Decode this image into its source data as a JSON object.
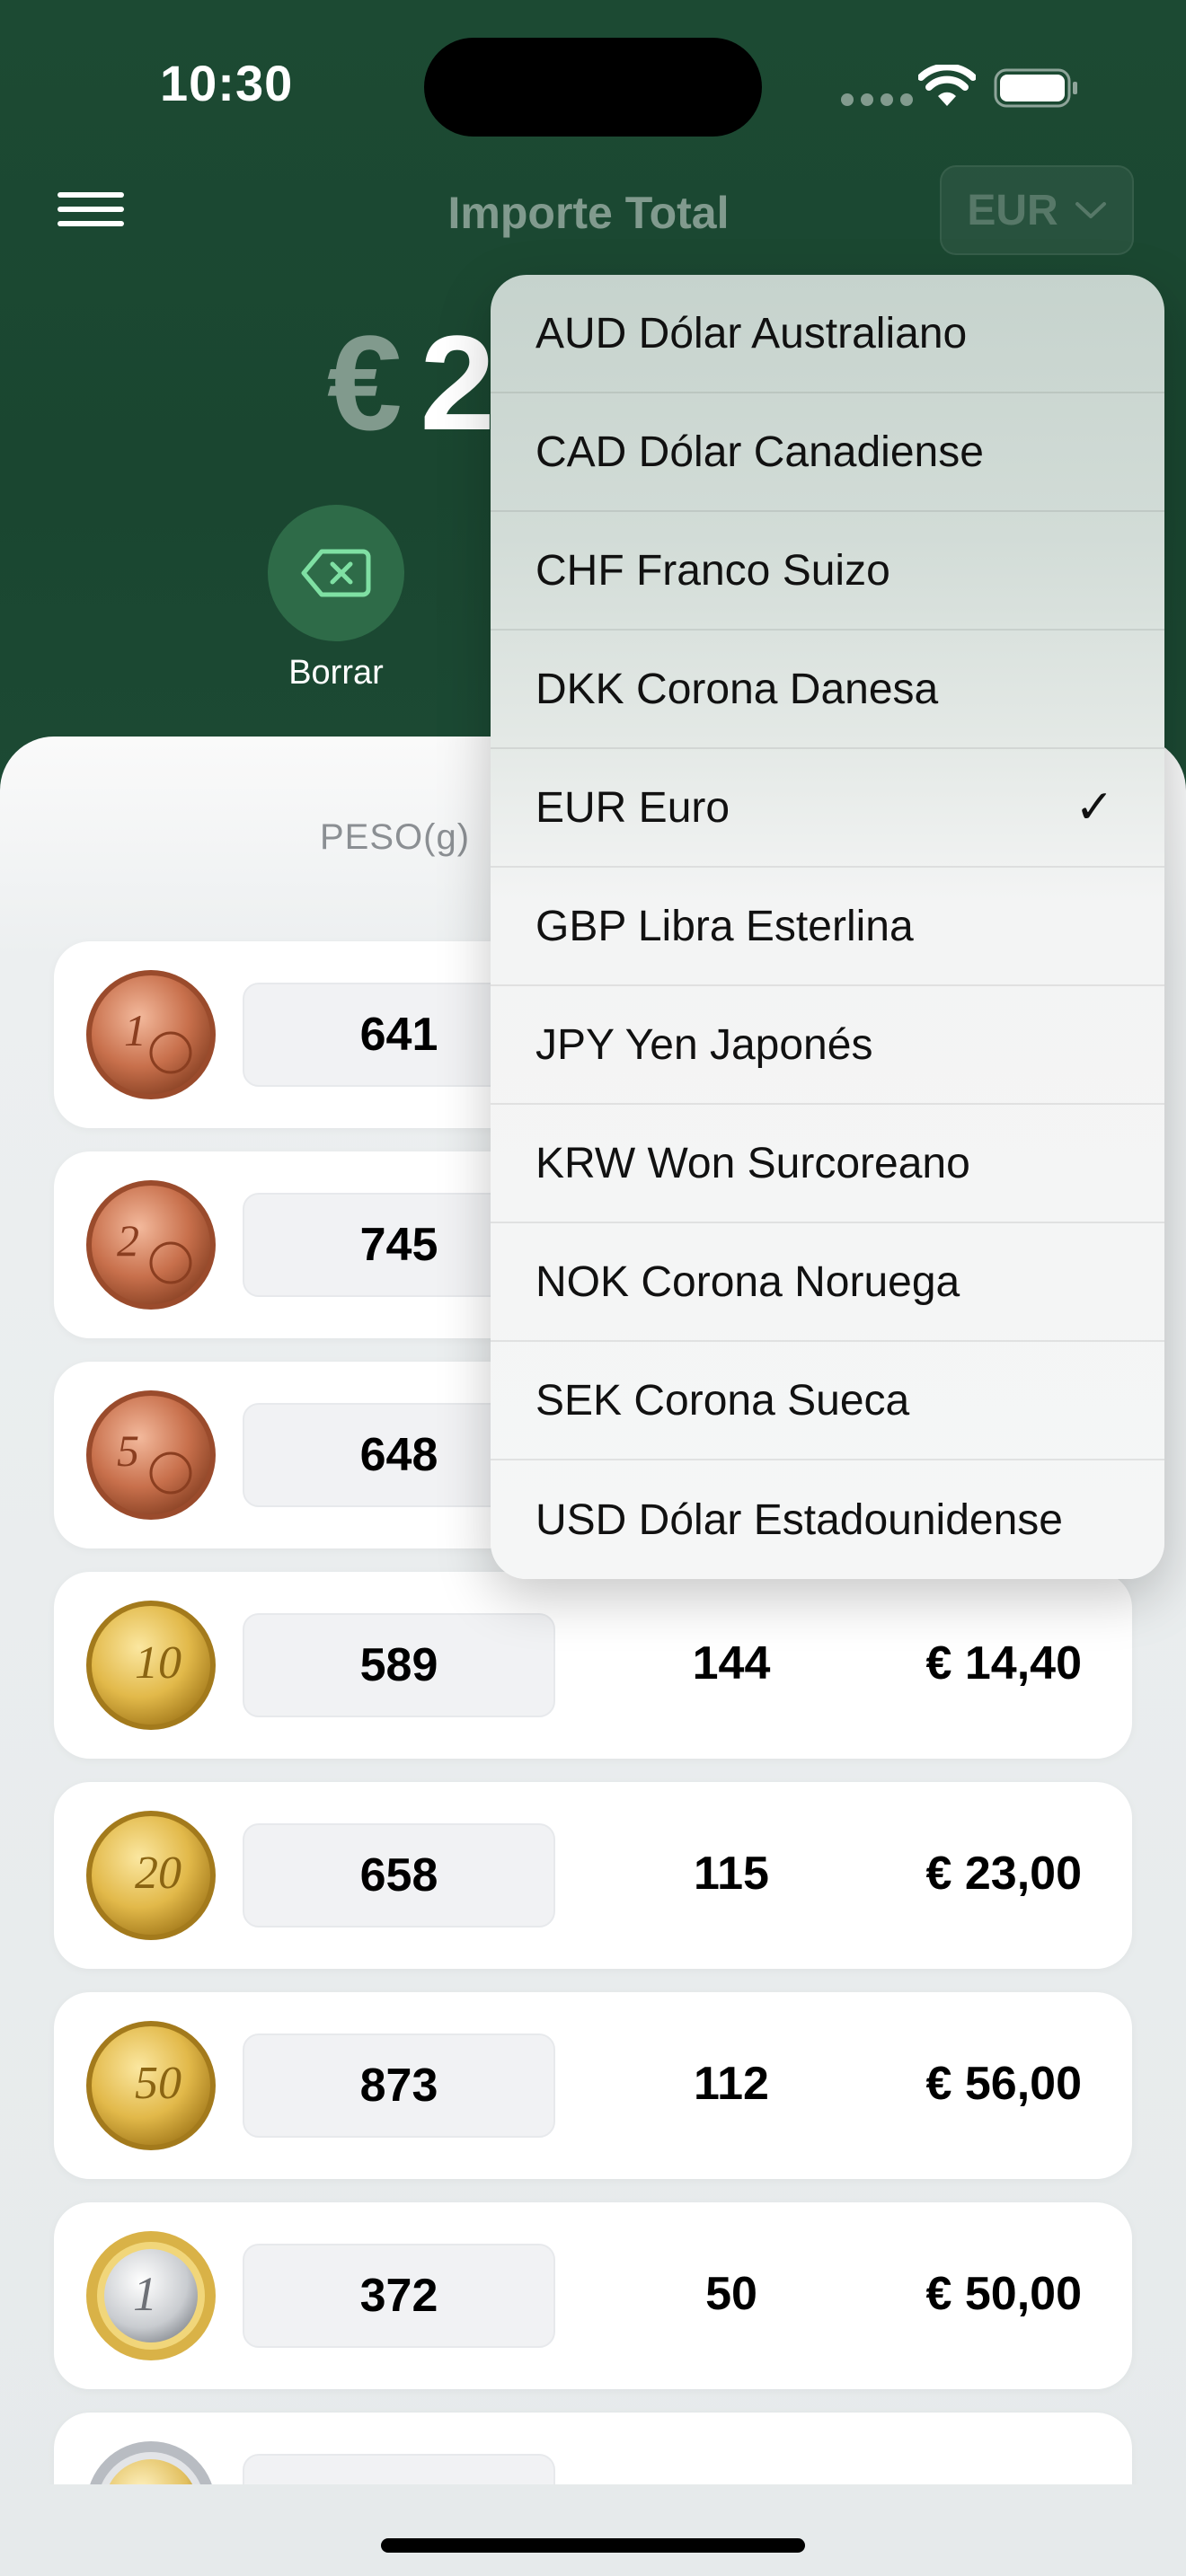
{
  "status_bar": {
    "time": "10:30"
  },
  "header": {
    "title": "Importe Total",
    "currency_button": "EUR",
    "total_symbol": "€",
    "total_visible": "2",
    "clear_label": "Borrar"
  },
  "table": {
    "column_weight": "PESO(g)",
    "rows": [
      {
        "coin": "1-cent-coin-icon",
        "weight": "641",
        "count": "",
        "value": ""
      },
      {
        "coin": "2-cent-coin-icon",
        "weight": "745",
        "count": "",
        "value": ""
      },
      {
        "coin": "5-cent-coin-icon",
        "weight": "648",
        "count": "",
        "value": ""
      },
      {
        "coin": "10-cent-coin-icon",
        "weight": "589",
        "count": "144",
        "value": "€ 14,40"
      },
      {
        "coin": "20-cent-coin-icon",
        "weight": "658",
        "count": "115",
        "value": "€ 23,00"
      },
      {
        "coin": "50-cent-coin-icon",
        "weight": "873",
        "count": "112",
        "value": "€ 56,00"
      },
      {
        "coin": "1-euro-coin-icon",
        "weight": "372",
        "count": "50",
        "value": "€ 50,00"
      },
      {
        "coin": "2-euro-coin-icon",
        "weight": "",
        "count": "",
        "value": ""
      }
    ]
  },
  "currency_menu": {
    "selected": "EUR Euro",
    "options": [
      "AUD Dólar Australiano",
      "CAD Dólar Canadiense",
      "CHF Franco Suizo",
      "DKK Corona Danesa",
      "EUR Euro",
      "GBP Libra Esterlina",
      "JPY Yen Japonés",
      "KRW Won Surcoreano",
      "NOK Corona Noruega",
      "SEK Corona Sueca",
      "USD Dólar Estadounidense"
    ]
  },
  "colors": {
    "header_green": "#1c4a33",
    "clear_button_green": "#2e6b48",
    "copper": "#c8704c",
    "gold": "#e2b94a",
    "page_background": "#e6eaeb"
  }
}
